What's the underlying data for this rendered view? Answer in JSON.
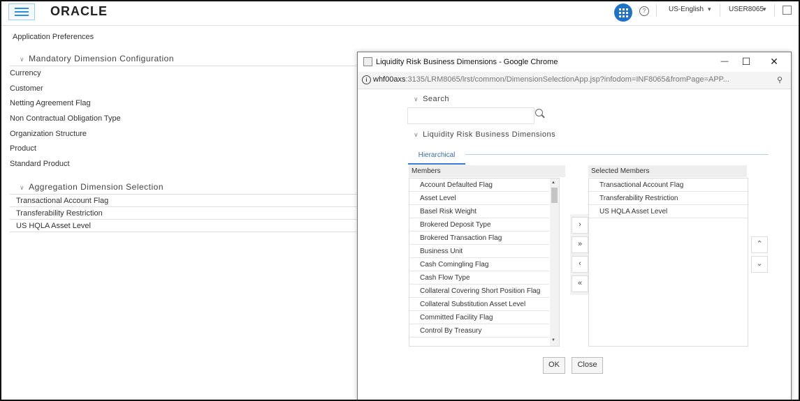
{
  "header": {
    "logo": "ORACLE",
    "language": "US-English",
    "user": "USER8065"
  },
  "page": {
    "title": "Application Preferences",
    "mandatory_section": "Mandatory Dimension Configuration",
    "mandatory_items": [
      "Currency",
      "Customer",
      "Netting Agreement Flag",
      "Non Contractual Obligation Type",
      "Organization Structure",
      "Product",
      "Standard Product"
    ],
    "aggregation_section": "Aggregation Dimension Selection",
    "aggregation_items": [
      "Transactional Account Flag",
      "Transferability Restriction",
      "US HQLA Asset Level"
    ]
  },
  "modal": {
    "window_title": "Liquidity Risk Business Dimensions - Google Chrome",
    "url_host": "whf00axs",
    "url_rest": ":3135/LRM8065/lrst/common/DimensionSelectionApp.jsp?infodom=INF8065&fromPage=APP...",
    "search_section": "Search",
    "search_placeholder": "",
    "dims_section": "Liquidity Risk Business Dimensions",
    "tab_label": "Hierarchical",
    "members_header": "Members",
    "selected_header": "Selected Members",
    "members": [
      "Account Defaulted Flag",
      "Asset Level",
      "Basel Risk Weight",
      "Brokered Deposit Type",
      "Brokered Transaction Flag",
      "Business Unit",
      "Cash Comingling Flag",
      "Cash Flow Type",
      "Collateral Covering Short Position Flag",
      "Collateral Substitution Asset Level",
      "Committed Facility Flag",
      "Control By Treasury"
    ],
    "selected": [
      "Transactional Account Flag",
      "Transferability Restriction",
      "US HQLA Asset Level"
    ],
    "ok_label": "OK",
    "close_label": "Close"
  },
  "icons": {
    "move_right": "›",
    "move_all_right": "»",
    "move_left": "‹",
    "move_all_left": "«",
    "move_up": "⌃",
    "move_down": "⌄",
    "caret_down": "▾",
    "caret_section": "∨",
    "minimize": "—",
    "maximize": "☐",
    "close": "✕"
  },
  "colors": {
    "accent": "#1e73c9",
    "tab_underline": "#3a7bd5"
  }
}
